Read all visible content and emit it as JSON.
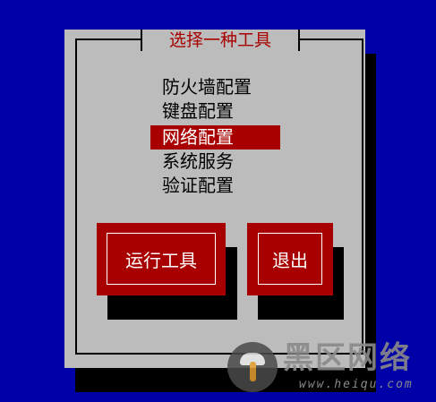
{
  "dialog": {
    "title": "选择一种工具",
    "menu": [
      {
        "label": "防火墙配置",
        "selected": false
      },
      {
        "label": "键盘配置",
        "selected": false
      },
      {
        "label": "网络配置",
        "selected": true
      },
      {
        "label": "系统服务",
        "selected": false
      },
      {
        "label": "验证配置",
        "selected": false
      }
    ],
    "buttons": {
      "run": "运行工具",
      "quit": "退出"
    }
  },
  "watermark": {
    "title": "黑区网络",
    "url": "www.heiqu.com"
  },
  "colors": {
    "background": "#0000a8",
    "dialog": "#bcbcbc",
    "accent": "#a80000"
  }
}
